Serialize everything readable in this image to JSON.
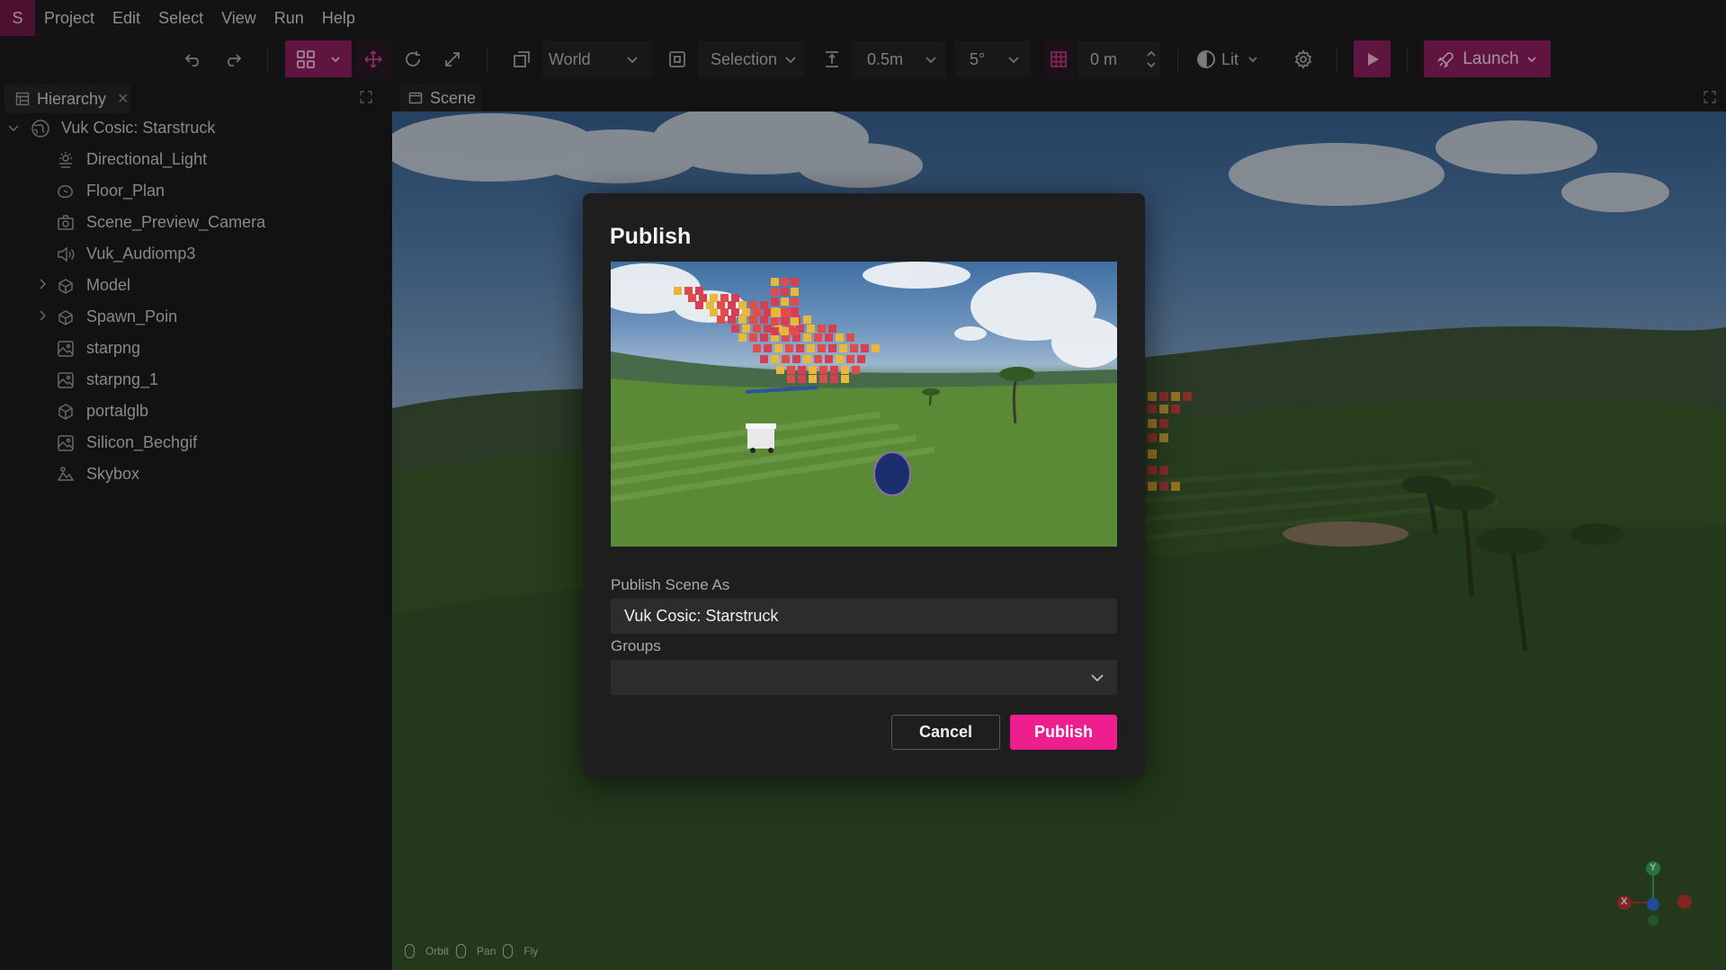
{
  "menubar": {
    "logo": "S",
    "items": [
      "Project",
      "Edit",
      "Select",
      "View",
      "Run",
      "Help"
    ]
  },
  "toolbar": {
    "space": "World",
    "pivot": "Selection",
    "snap_distance": "0.5m",
    "snap_angle": "5°",
    "grid_value": "0 m",
    "lighting": "Lit",
    "launch_label": "Launch",
    "accent_color": "#8e1f61"
  },
  "hierarchy": {
    "tab_label": "Hierarchy",
    "root": "Vuk Cosic: Starstruck",
    "items": [
      {
        "label": "Directional_Light",
        "icon": "light-icon"
      },
      {
        "label": "Floor_Plan",
        "icon": "floor-icon"
      },
      {
        "label": "Scene_Preview_Camera",
        "icon": "camera-icon"
      },
      {
        "label": "Vuk_Audiomp3",
        "icon": "speaker-icon"
      },
      {
        "label": "Model",
        "icon": "model-icon"
      },
      {
        "label": "Spawn_Poin",
        "icon": "model-icon"
      },
      {
        "label": "starpng",
        "icon": "image-icon"
      },
      {
        "label": "starpng_1",
        "icon": "image-icon"
      },
      {
        "label": "portalglb",
        "icon": "box-icon"
      },
      {
        "label": "Silicon_Bechgif",
        "icon": "image-icon"
      },
      {
        "label": "Skybox",
        "icon": "skybox-icon"
      }
    ]
  },
  "scene": {
    "tab_label": "Scene",
    "hints": [
      "Orbit",
      "Pan",
      "Fly"
    ],
    "gizmo_axes": [
      "Y",
      "X"
    ]
  },
  "publish_dialog": {
    "title": "Publish",
    "scene_name_label": "Publish Scene As",
    "scene_name_value": "Vuk Cosic: Starstruck",
    "groups_label": "Groups",
    "groups_value": "",
    "cancel_label": "Cancel",
    "publish_label": "Publish",
    "publish_color": "#ee1e8e"
  }
}
